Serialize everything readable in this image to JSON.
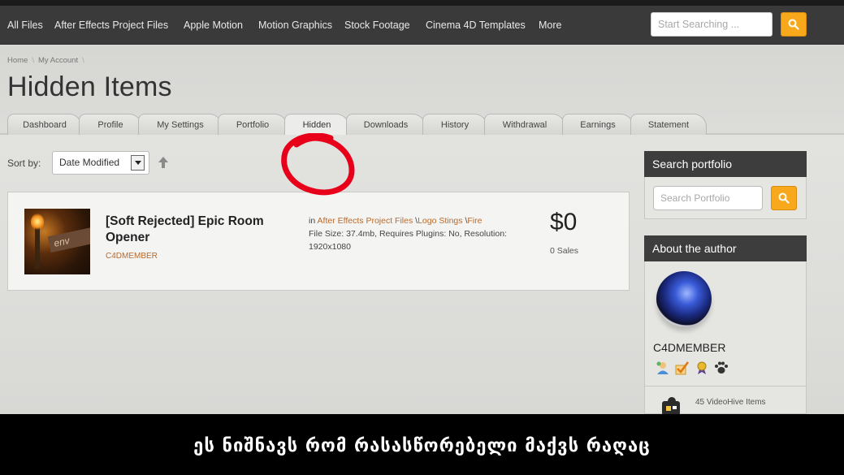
{
  "nav": {
    "items": [
      "All Files",
      "After Effects Project Files",
      "Apple Motion",
      "Motion Graphics",
      "Stock Footage",
      "Cinema 4D Templates",
      "More"
    ],
    "search_placeholder": "Start Searching ..."
  },
  "breadcrumb": [
    "Home",
    "My Account"
  ],
  "page_title": "Hidden Items",
  "tabs": [
    "Dashboard",
    "Profile",
    "My Settings",
    "Portfolio",
    "Hidden",
    "Downloads",
    "History",
    "Withdrawal",
    "Earnings",
    "Statement"
  ],
  "active_tab": "Hidden",
  "sort": {
    "label": "Sort by:",
    "value": "Date Modified"
  },
  "item": {
    "title": "[Soft Rejected] Epic Room Opener",
    "author": "C4DMEMBER",
    "in_label": "in",
    "categories": [
      "After Effects Project Files",
      "Logo Stings",
      "Fire"
    ],
    "details": "File Size: 37.4mb, Requires Plugins: No, Resolution: 1920x1080",
    "price": "$0",
    "sales": "0 Sales",
    "thumb_text": "env"
  },
  "sidebar": {
    "search_title": "Search portfolio",
    "search_placeholder": "Search Portfolio",
    "about_title": "About the author",
    "author_name": "C4DMEMBER",
    "items_count": "45 VideoHive Items",
    "badges": [
      "member-icon",
      "check-icon",
      "award-icon",
      "paw-icon"
    ]
  },
  "caption": "ეს ნიშნავს რომ რასასწორებელი მაქვს რაღაც",
  "colors": {
    "accent": "#f7a81b",
    "link": "#b86a2c",
    "nav_bg": "#3a3a3a",
    "annotation": "#e8001a"
  }
}
